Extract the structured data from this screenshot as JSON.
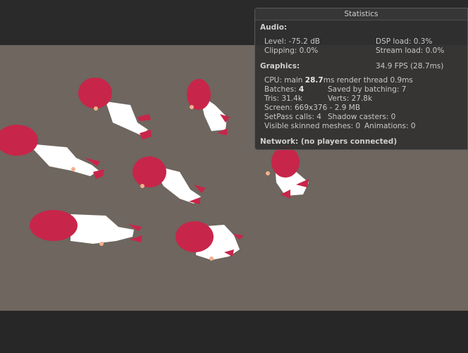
{
  "stats": {
    "title": "Statistics",
    "audio": {
      "header": "Audio:",
      "level": "Level: -75.2 dB",
      "dsp": "DSP load: 0.3%",
      "clipping": "Clipping: 0.0%",
      "stream": "Stream load: 0.0%"
    },
    "graphics": {
      "header": "Graphics:",
      "fps": "34.9 FPS (28.7ms)",
      "cpu_prefix": "CPU: main ",
      "cpu_main": "28.7",
      "cpu_suffix": "ms  render thread 0.9ms",
      "batches_prefix": "Batches: ",
      "batches": "4",
      "saved": "Saved by batching: 7",
      "tris": "Tris: 31.4k",
      "verts": "Verts: 27.8k",
      "screen": "Screen: 669x376 - 2.9 MB",
      "setpass": "SetPass calls: 4",
      "shadow": "Shadow casters: 0",
      "skinned": "Visible skinned meshes: 0",
      "animations": "Animations: 0"
    },
    "network": "Network: (no players connected)"
  },
  "colors": {
    "viewport_bg": "#6e665f",
    "hair": "#c8254a",
    "body": "#ffffff",
    "skin": "#f2b08c"
  }
}
